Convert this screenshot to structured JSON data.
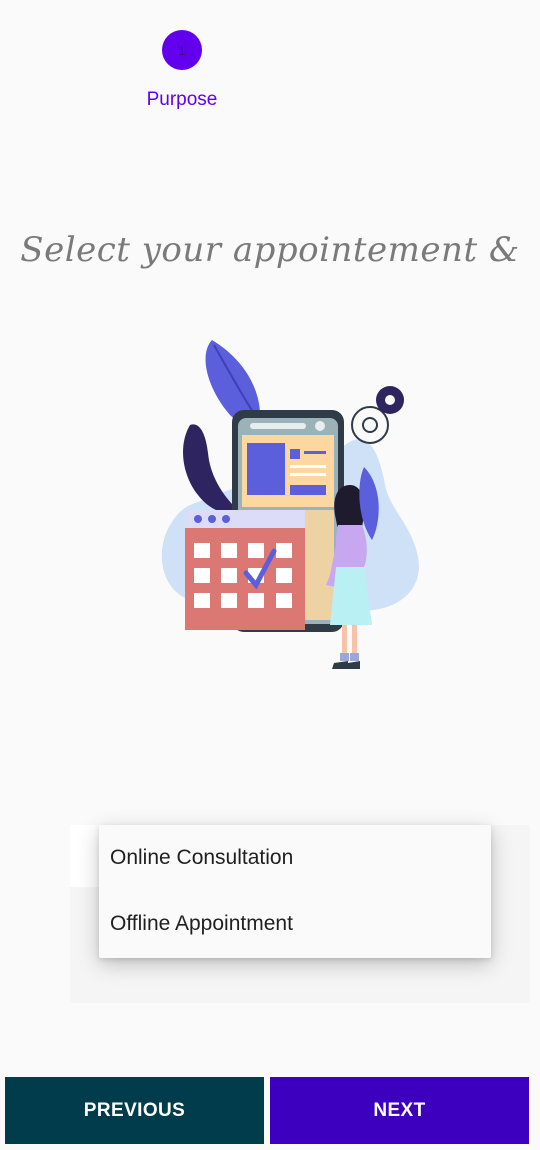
{
  "stepper": {
    "step_number": "1",
    "step_label": "Purpose",
    "active_color": "#6200ee"
  },
  "heading": {
    "title": "Select your appointement &"
  },
  "illustration": {
    "icon": "appointment-calendar-illustration"
  },
  "dropdown": {
    "options": [
      "Online Consultation",
      "Offline Appointment"
    ]
  },
  "buttons": {
    "previous_label": "PREVIOUS",
    "next_label": "NEXT",
    "previous_color": "#003c4c",
    "next_color": "#3d00bf"
  }
}
